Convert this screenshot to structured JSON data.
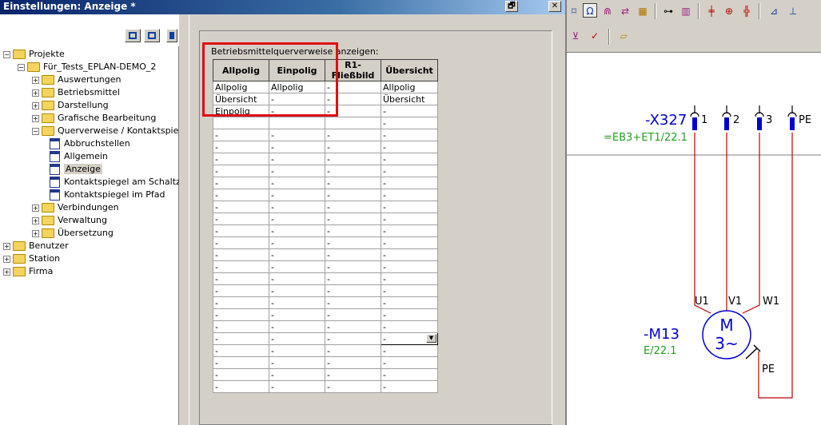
{
  "window": {
    "title": "Einstellungen: Anzeige *",
    "restore_glyph": "🗗",
    "close_glyph": "✕"
  },
  "tree": {
    "items": [
      {
        "label": "Projekte",
        "level": 0,
        "type": "folder",
        "expander": "−"
      },
      {
        "label": "Für_Tests_EPLAN-DEMO_2",
        "level": 1,
        "type": "folder",
        "expander": "−"
      },
      {
        "label": "Auswertungen",
        "level": 2,
        "type": "folder",
        "expander": "+"
      },
      {
        "label": "Betriebsmittel",
        "level": 2,
        "type": "folder",
        "expander": "+"
      },
      {
        "label": "Darstellung",
        "level": 2,
        "type": "folder",
        "expander": "+"
      },
      {
        "label": "Grafische Bearbeitung",
        "level": 2,
        "type": "folder",
        "expander": "+"
      },
      {
        "label": "Querverweise / Kontaktspiegel",
        "level": 2,
        "type": "folder",
        "expander": "−"
      },
      {
        "label": "Abbruchstellen",
        "level": 3,
        "type": "page"
      },
      {
        "label": "Allgemein",
        "level": 3,
        "type": "page"
      },
      {
        "label": "Anzeige",
        "level": 3,
        "type": "page",
        "selected": true
      },
      {
        "label": "Kontaktspiegel am Schaltz",
        "level": 3,
        "type": "page"
      },
      {
        "label": "Kontaktspiegel im Pfad",
        "level": 3,
        "type": "page"
      },
      {
        "label": "Verbindungen",
        "level": 2,
        "type": "folder",
        "expander": "+"
      },
      {
        "label": "Verwaltung",
        "level": 2,
        "type": "folder",
        "expander": "+"
      },
      {
        "label": "Übersetzung",
        "level": 2,
        "type": "folder",
        "expander": "+"
      },
      {
        "label": "Benutzer",
        "level": 0,
        "type": "folder",
        "expander": "+"
      },
      {
        "label": "Station",
        "level": 0,
        "type": "folder",
        "expander": "+"
      },
      {
        "label": "Firma",
        "level": 0,
        "type": "folder",
        "expander": "+"
      }
    ]
  },
  "settings": {
    "label": "Betriebsmittelquerverweise anzeigen:",
    "columns": [
      "Allpolig",
      "Einpolig",
      "R1-Fließbild",
      "Übersicht"
    ],
    "rows": [
      [
        "Allpolig",
        "Allpolig",
        "-",
        "Allpolig"
      ],
      [
        "Übersicht",
        "-",
        "-",
        "Übersicht"
      ],
      [
        "Einpolig",
        "-",
        "-",
        "-"
      ],
      [
        "",
        "",
        "",
        "-"
      ],
      [
        "-",
        "-",
        "-",
        "-"
      ],
      [
        "-",
        "-",
        "-",
        "-"
      ],
      [
        "-",
        "-",
        "-",
        "-"
      ],
      [
        "-",
        "-",
        "-",
        "-"
      ],
      [
        "-",
        "-",
        "-",
        "-"
      ],
      [
        "-",
        "-",
        "-",
        "-"
      ],
      [
        "-",
        "-",
        "-",
        "-"
      ],
      [
        "-",
        "-",
        "-",
        "-"
      ],
      [
        "-",
        "-",
        "-",
        "-"
      ],
      [
        "-",
        "-",
        "-",
        "-"
      ],
      [
        "-",
        "-",
        "-",
        "-"
      ],
      [
        "-",
        "-",
        "-",
        "-"
      ],
      [
        "-",
        "-",
        "-",
        "-"
      ],
      [
        "-",
        "-",
        "-",
        "-"
      ],
      [
        "-",
        "-",
        "-",
        "-"
      ],
      [
        "-",
        "-",
        "-",
        "-"
      ],
      [
        "-",
        "-",
        "-",
        "-"
      ],
      [
        "-",
        "-",
        "-",
        "-"
      ],
      [
        "-",
        "-",
        "-",
        "-"
      ],
      [
        "-",
        "-",
        "-",
        "-"
      ],
      [
        "-",
        "-",
        "-",
        "-"
      ],
      [
        "-",
        "-",
        "-",
        "-"
      ]
    ],
    "dropdown_row": 21,
    "dropdown_value": "-",
    "highlight_color": "#e01010"
  },
  "schematic": {
    "terminal_strip": "-X327",
    "strip_location": "=EB3+ET1/22.1",
    "terminals": [
      "1",
      "2",
      "3",
      "PE"
    ],
    "motor": "-M13",
    "motor_ref": "E/22.1",
    "motor_symbol_top": "M",
    "motor_symbol_bottom": "3~",
    "motor_pins": [
      "U1",
      "V1",
      "W1"
    ],
    "pe_label": "PE",
    "wire_color": "#c00000",
    "symbol_color": "#0000d0",
    "ref_color": "#20a020"
  },
  "toolbar": {
    "icons": [
      "zoom-icon",
      "ohm-icon",
      "magnet-icon",
      "connect-icon",
      "chart-icon",
      "binoculars-icon",
      "bookmark-icon",
      "crosshair-icon",
      "target-icon",
      "grid-icon",
      "angle-icon",
      "pen-icon",
      "cart-icon",
      "check-icon",
      "folder-open-icon"
    ]
  }
}
